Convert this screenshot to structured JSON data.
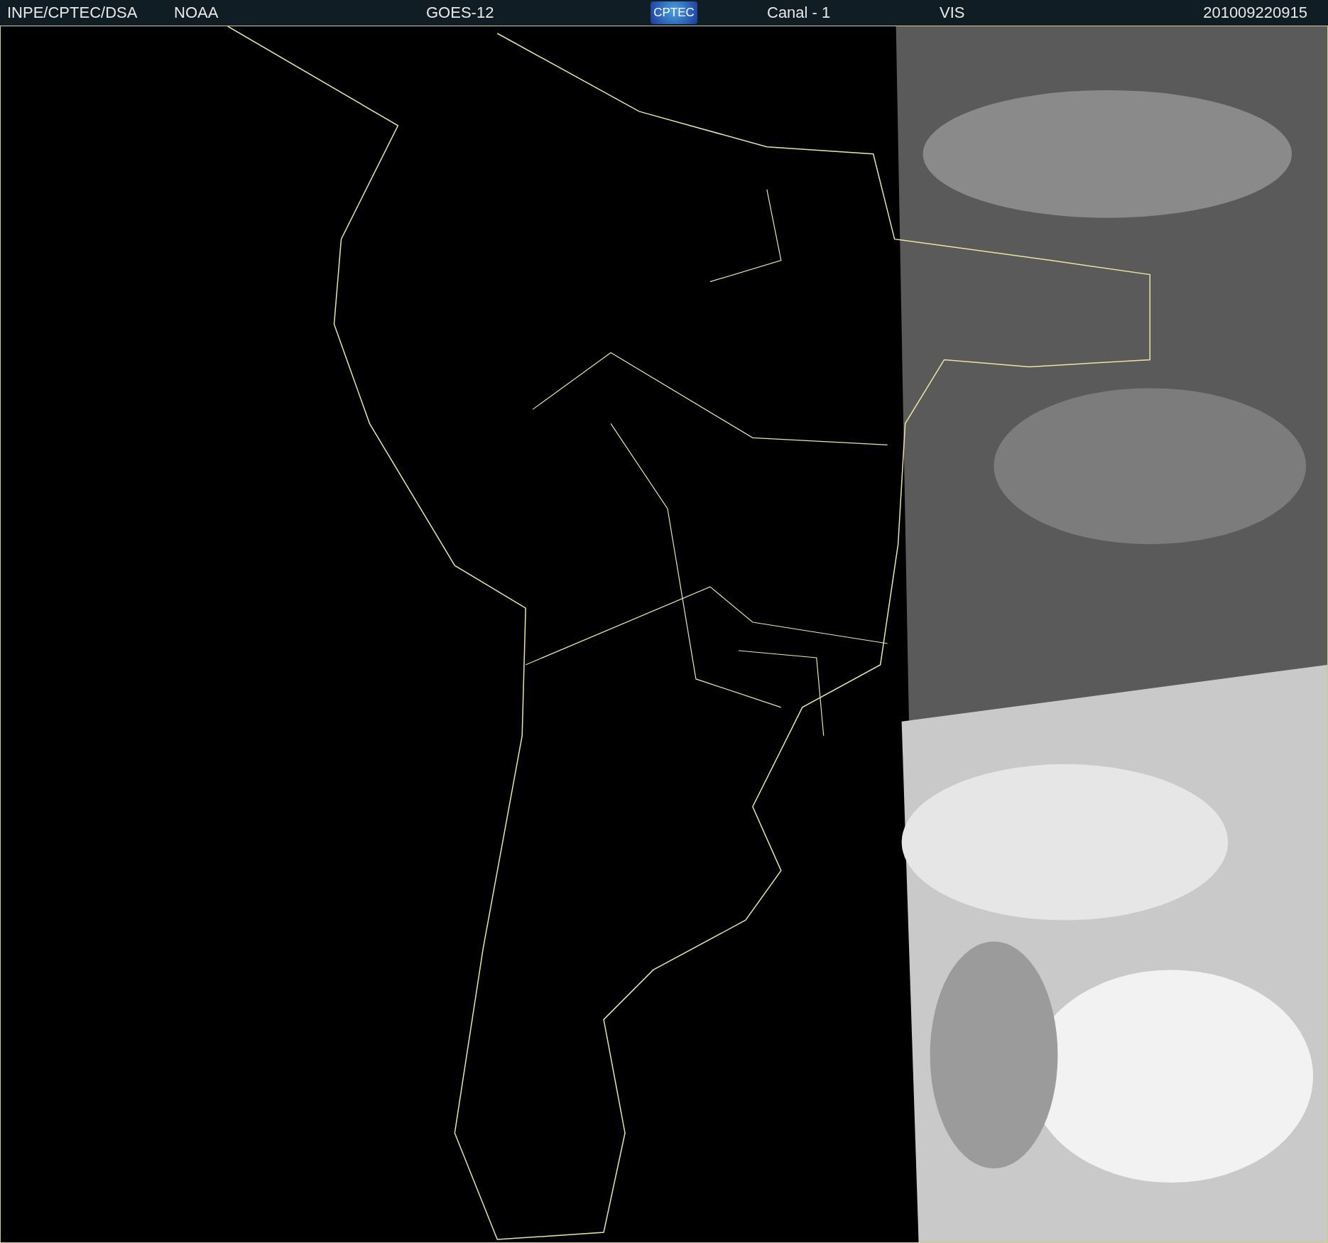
{
  "header": {
    "source": "INPE/CPTEC/DSA",
    "agency": "NOAA",
    "satellite": "GOES-12",
    "logo": "CPTEC",
    "channel": "Canal - 1",
    "band": "VIS",
    "timestamp": "201009220915"
  }
}
